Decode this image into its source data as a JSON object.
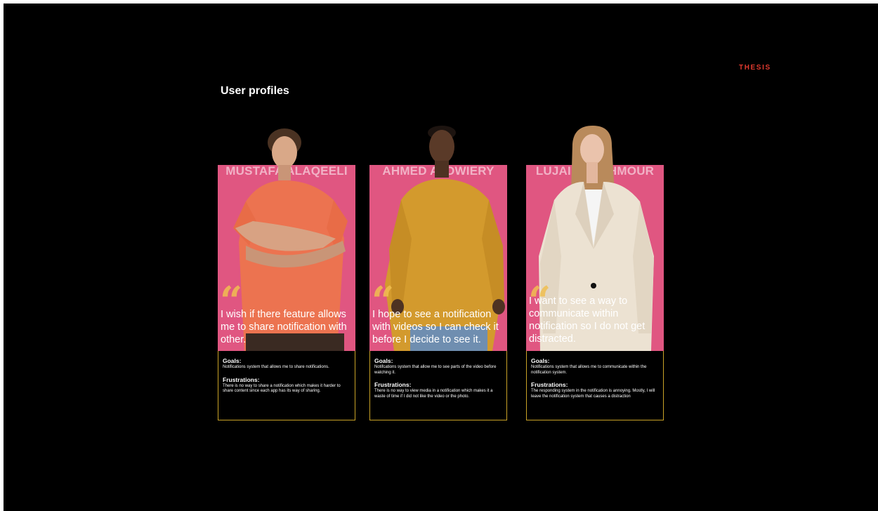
{
  "brand": "THESIS",
  "title": "User profiles",
  "colors": {
    "background": "#000000",
    "card_pink": "#e05681",
    "border_gold": "#c9a227",
    "brand_red": "#e03a2f"
  },
  "labels": {
    "goals": "Goals:",
    "frustrations": "Frustrations:"
  },
  "profiles": [
    {
      "name": "MUSTAFA ALAQEELI",
      "quote": "I wish if there feature allows me to share notification with other.",
      "goals": "Notifications system that allows me to share notifications.",
      "frustrations": "There is no way to share a notification which makes it harder to share content since each app has its way of sharing."
    },
    {
      "name": "AHMED ALDWIERY",
      "quote": "I hope to see a notification with videos so I can check it before I decide to see it.",
      "goals": "Notifcations system that allow me to see parts of the video before watching it.",
      "frustrations": "There is no way to view media in a notification which makes it a waste of time if I did not like the video or the photo."
    },
    {
      "name": "LUJAIN YAGHMOUR",
      "quote": "I want to see  a way to communicate within notification so I do not get distracted.",
      "goals": "Notifications system that allows me to communicate within the notification system.",
      "frustrations": "The responding system in the notification is annoying. Mostly, I will leave the notification system that causes a distraction"
    }
  ]
}
